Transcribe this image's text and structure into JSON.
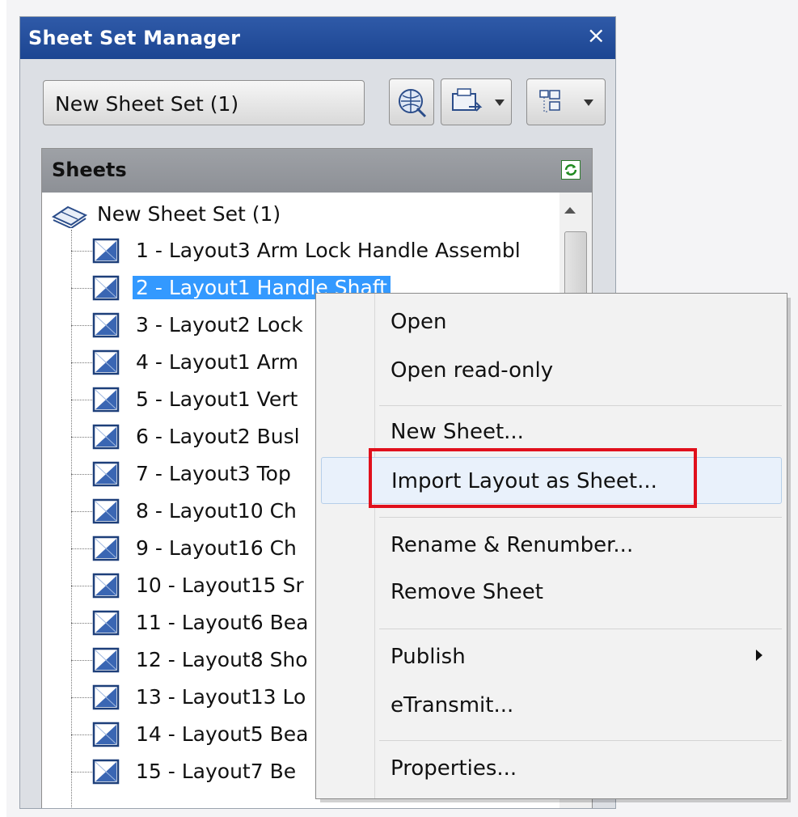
{
  "palette": {
    "title": "Sheet Set Manager",
    "close_label": "×",
    "selector_value": "New Sheet Set (1)"
  },
  "sheets_panel": {
    "header": "Sheets",
    "root_label": "New Sheet Set (1)",
    "items": [
      {
        "label": "1 - Layout3 Arm Lock Handle Assembl"
      },
      {
        "label": "2 - Layout1 Handle Shaft",
        "selected": true
      },
      {
        "label": "3 - Layout2 Lock"
      },
      {
        "label": "4 - Layout1 Arm"
      },
      {
        "label": "5 - Layout1 Vert"
      },
      {
        "label": "6 - Layout2 Busl"
      },
      {
        "label": "7 - Layout3 Top"
      },
      {
        "label": "8 - Layout10 Ch"
      },
      {
        "label": "9 - Layout16 Ch"
      },
      {
        "label": "10 - Layout15 Sr"
      },
      {
        "label": "11 - Layout6 Bea"
      },
      {
        "label": "12 - Layout8 Sho"
      },
      {
        "label": "13 - Layout13 Lo"
      },
      {
        "label": "14 - Layout5 Bea"
      },
      {
        "label": "15 - Layout7 Be"
      }
    ]
  },
  "context_menu": {
    "items": [
      {
        "label": "Open"
      },
      {
        "label": "Open read-only"
      },
      {
        "label": "New Sheet..."
      },
      {
        "label": "Import Layout as Sheet...",
        "hover": true,
        "highlighted": true
      },
      {
        "label": "Rename & Renumber..."
      },
      {
        "label": "Remove Sheet"
      },
      {
        "label": "Publish",
        "has_submenu": true
      },
      {
        "label": "eTransmit..."
      },
      {
        "label": "Properties..."
      }
    ]
  },
  "colors": {
    "titlebar": "#1c4592",
    "selection": "#3399ff",
    "highlight_box": "#e0101c"
  }
}
